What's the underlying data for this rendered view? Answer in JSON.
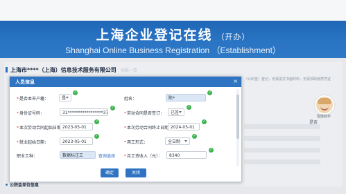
{
  "banner": {
    "title_cn": "上海企业登记在线",
    "title_sub": "（开办）",
    "title_en": "Shanghai Online Business Registration （Establishment）"
  },
  "background": {
    "company_name": "上海市****（上海）信息技术服务有限公司",
    "company_hint": "功能一览",
    "right_notice": "（公积金）登记，无需提交书面材料，无需领取纸质凭证",
    "select_label": "是否",
    "section_title": "公积金单位信息"
  },
  "assistant": {
    "label": "智能助手"
  },
  "modal": {
    "title": "人员信息",
    "close_icon": "×",
    "fields": {
      "shanghai_local_label": "是否本市户籍：",
      "shanghai_local_value": "是",
      "name_label": "姓名：",
      "name_value": "陈*",
      "id_label": "身份证号码：",
      "id_value": "31*****************37",
      "contract_signed_label": "劳动合同是否签订：",
      "contract_signed_value": "已签",
      "contract_start_label": "本次劳动合同起始日期：",
      "contract_start_value": "2023-05-01",
      "contract_end_label": "本次劳动合同终止日期：",
      "contract_end_value": "2024-05-01",
      "employment_start_label": "就业起始日期：",
      "employment_start_value": "2023-05-01",
      "work_type_label": "用工形式：",
      "work_type_value": "全日制",
      "job_label": "职业工种：",
      "job_value": "数据标注工",
      "job_link": "查询选择",
      "salary_label": "月工资收入（元）：",
      "salary_value": "8340"
    },
    "buttons": {
      "confirm": "确定",
      "close": "关闭"
    }
  },
  "colors": {
    "banner": "#2a74c4",
    "accent": "#2e74c2",
    "success": "#3fb34f",
    "required": "#e23a3a"
  }
}
